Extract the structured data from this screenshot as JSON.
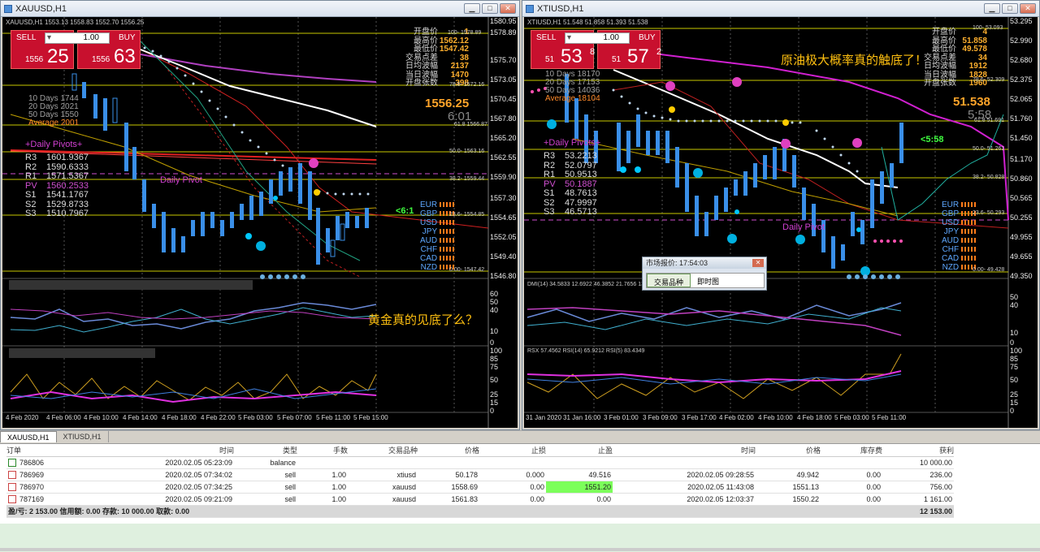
{
  "w1": {
    "title": "XAUUSD,H1",
    "symbol": "XAUUSD,H1  1553.13 1558.83 1552.70 1556.25",
    "sell": "SELL",
    "buy": "BUY",
    "lot": "1.00",
    "sell_pre": "1556",
    "sell_big": "25",
    "buy_pre": "1556",
    "buy_big": "63",
    "days": [
      "10 Days  1744",
      "20 Days  2021",
      "50 Days  1550",
      "Average  2001"
    ],
    "info": [
      [
        "开盘价",
        "1"
      ],
      [
        "最高价",
        "1562.12"
      ],
      [
        "最低价",
        "1547.42"
      ],
      [
        "交易点差",
        "38"
      ],
      [
        "日均波幅",
        "2137"
      ],
      [
        "当日波幅",
        "1470"
      ],
      [
        "开盘张数",
        "398"
      ]
    ],
    "price": "1556.25",
    "countdown": "6:01",
    "pivots": [
      [
        "R3",
        "1601.9367"
      ],
      [
        "R2",
        "1590.6333"
      ],
      [
        "R1",
        "1571.5367"
      ],
      [
        "PV",
        "1560.2533"
      ],
      [
        "S1",
        "1541.1767"
      ],
      [
        "S2",
        "1529.8733"
      ],
      [
        "S3",
        "1510.7967"
      ]
    ],
    "pivot_head": "+Daily Pivots+",
    "daily_pivot": "Daily Pivot",
    "arrow": "<6:1",
    "ccy": [
      "EUR",
      "GBP",
      "USD",
      "JPY",
      "AUD",
      "CHF",
      "CAD",
      "NZD"
    ],
    "fib": [
      "100- 1578.89",
      "78.6- 1572.16",
      "61.8 1566.87",
      "50.0- 1563.16",
      "38.2- 1559.44",
      "23.6- 1554.85",
      "0.00- 1547.42"
    ],
    "yaxis": [
      "1580.95",
      "1578.89",
      "1575.70",
      "1573.05",
      "1570.45",
      "1567.80",
      "1565.20",
      "1562.55",
      "1559.90",
      "1557.30",
      "1554.65",
      "1552.05",
      "1549.40",
      "1546.80"
    ],
    "note": "黄金真的见底了么？",
    "xaxis": [
      "4 Feb 2020",
      "4 Feb 06:00",
      "4 Feb 10:00",
      "4 Feb 14:00",
      "4 Feb 18:00",
      "4 Feb 22:00",
      "5 Feb 03:00",
      "5 Feb 07:00",
      "5 Feb 11:00",
      "5 Feb 15:00"
    ],
    "ind_y1": [
      "60",
      "50",
      "40",
      "10",
      "0"
    ],
    "ind_y2": [
      "100",
      "85",
      "75",
      "50",
      "25",
      "15",
      "0"
    ]
  },
  "w2": {
    "title": "XTIUSD,H1",
    "symbol": "XTIUSD,H1  51.548 51.858 51.393 51.538",
    "sell": "SELL",
    "buy": "BUY",
    "lot": "1.00",
    "sell_pre": "51",
    "sell_big": "53",
    "sell_sup": "8",
    "buy_pre": "51",
    "buy_big": "57",
    "buy_sup": "2",
    "days": [
      "10 Days  18170",
      "20 Days  17153",
      "50 Days  14036",
      "Average  18104"
    ],
    "info": [
      [
        "开盘价",
        "4"
      ],
      [
        "最高价",
        "51.858"
      ],
      [
        "最低价",
        "49.578"
      ],
      [
        "交易点差",
        "34"
      ],
      [
        "日均波幅",
        "1912"
      ],
      [
        "当日波幅",
        "1828"
      ],
      [
        "开盘张数",
        "1960"
      ]
    ],
    "price": "51.538",
    "countdown": "5:58",
    "pivots": [
      [
        "R3",
        "53.2213"
      ],
      [
        "R2",
        "52.0797"
      ],
      [
        "R1",
        "50.9513"
      ],
      [
        "PV",
        "50.1887"
      ],
      [
        "S1",
        "48.7613"
      ],
      [
        "S2",
        "47.9997"
      ],
      [
        "S3",
        "46.5713"
      ]
    ],
    "pivot_head": "+Daily Pivots+",
    "daily_pivot": "Daily Pivot",
    "arrow": "<5:58",
    "ccy": [
      "EUR",
      "GBP",
      "USD",
      "JPY",
      "AUD",
      "CHF",
      "CAD",
      "NZD"
    ],
    "fib": [
      "100- 53.093",
      "78.6- 52.309",
      "61.8 51.691",
      "50.0- 51.261",
      "38.2- 50.828",
      "23.6- 50.293",
      "0.00- 49.428"
    ],
    "yaxis": [
      "53.295",
      "52.990",
      "52.680",
      "52.375",
      "52.065",
      "51.760",
      "51.450",
      "51.170",
      "50.860",
      "50.565",
      "50.255",
      "49.955",
      "49.655",
      "49.350"
    ],
    "note": "原油极大概率真的触底了！",
    "ind1": "DMI(14) 34.5833 12.6922 46.3852 21.7656 13.8211",
    "ind2": "RSX 57.4562  RSI(14) 65.9212  RSI(5) 83.4349",
    "xaxis": [
      "31 Jan 2020",
      "31 Jan 16:00",
      "3 Feb 01:00",
      "3 Feb 09:00",
      "3 Feb 17:00",
      "4 Feb 02:00",
      "4 Feb 10:00",
      "4 Feb 18:00",
      "5 Feb 03:00",
      "5 Feb 11:00"
    ],
    "ind_y1": [
      "50",
      "40",
      "10",
      "0"
    ],
    "ind_y2": [
      "100",
      "85",
      "75",
      "50",
      "25",
      "15",
      "0"
    ]
  },
  "popup": {
    "title": "市场报价: 17:54:03",
    "tab1": "交易品种",
    "tab2": "即时图"
  },
  "tabs": [
    "XAUUSD,H1",
    "XTIUSD,H1"
  ],
  "table": {
    "headers": [
      "订单",
      "时间",
      "类型",
      "手数",
      "交易品种",
      "价格",
      "止损",
      "止盈",
      "时间",
      "价格",
      "库存费",
      "获利"
    ],
    "rows": [
      [
        "786806",
        "2020.02.05 05:23:09",
        "balance",
        "",
        "",
        "",
        "",
        "",
        "",
        "",
        "",
        "10 000.00"
      ],
      [
        "786969",
        "2020.02.05 07:34:02",
        "sell",
        "1.00",
        "xtiusd",
        "50.178",
        "0.000",
        "49.516",
        "2020.02.05 09:28:55",
        "49.942",
        "0.00",
        "236.00"
      ],
      [
        "786970",
        "2020.02.05 07:34:25",
        "sell",
        "1.00",
        "xauusd",
        "1558.69",
        "0.00",
        "1551.20",
        "2020.02.05 11:43:08",
        "1551.13",
        "0.00",
        "756.00"
      ],
      [
        "787169",
        "2020.02.05 09:21:09",
        "sell",
        "1.00",
        "xauusd",
        "1561.83",
        "0.00",
        "0.00",
        "2020.02.05 12:03:37",
        "1550.22",
        "0.00",
        "1 161.00"
      ]
    ],
    "summary": "盈/亏: 2 153.00  信用额: 0.00  存款: 10 000.00  取款: 0.00",
    "total": "12 153.00"
  }
}
